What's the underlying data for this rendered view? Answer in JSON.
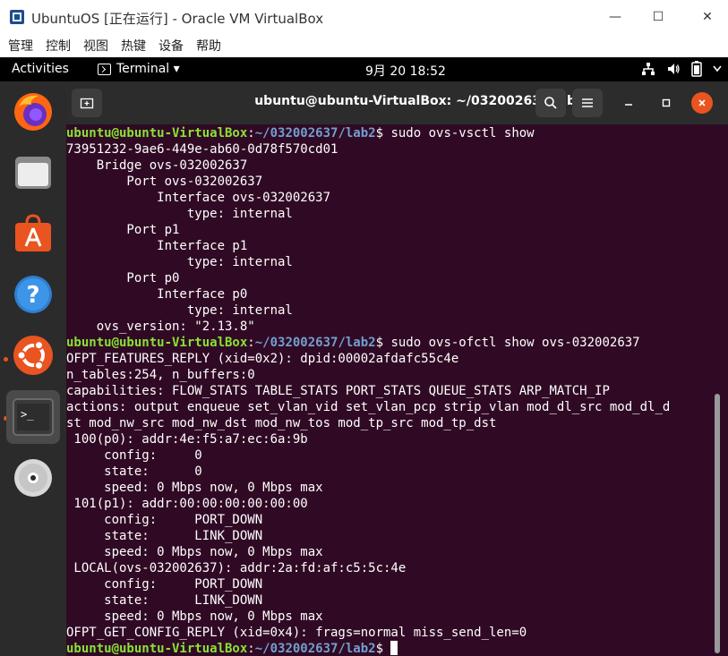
{
  "window": {
    "title": "UbuntuOS [正在运行] - Oracle VM VirtualBox",
    "minimize_glyph": "—",
    "maximize_glyph": "☐",
    "close_glyph": "✕"
  },
  "menubar": {
    "items": [
      "管理",
      "控制",
      "视图",
      "热键",
      "设备",
      "帮助"
    ]
  },
  "topbar": {
    "activities": "Activities",
    "app_menu": "Terminal ▾",
    "clock": "9月 20  18:52",
    "tray_icons": [
      "network-icon",
      "volume-icon",
      "battery-icon",
      "power-menu-icon"
    ]
  },
  "dock": {
    "items": [
      "firefox-icon",
      "files-icon",
      "software-icon",
      "help-icon",
      "ubuntu-icon",
      "terminal-icon",
      "disc-icon"
    ]
  },
  "terminal": {
    "title": "ubuntu@ubuntu-VirtualBox: ~/032002637/lab2",
    "prompt_user": "ubuntu@ubuntu-VirtualBox",
    "prompt_sep": ":",
    "prompt_path": "~/032002637/lab2",
    "prompt_end": "$ ",
    "lines": [
      {
        "type": "cmd",
        "text": "sudo ovs-vsctl show"
      },
      {
        "type": "out",
        "text": "73951232-9ae6-449e-ab60-0d78f570cd01"
      },
      {
        "type": "out",
        "text": "    Bridge ovs-032002637"
      },
      {
        "type": "out",
        "text": "        Port ovs-032002637"
      },
      {
        "type": "out",
        "text": "            Interface ovs-032002637"
      },
      {
        "type": "out",
        "text": "                type: internal"
      },
      {
        "type": "out",
        "text": "        Port p1"
      },
      {
        "type": "out",
        "text": "            Interface p1"
      },
      {
        "type": "out",
        "text": "                type: internal"
      },
      {
        "type": "out",
        "text": "        Port p0"
      },
      {
        "type": "out",
        "text": "            Interface p0"
      },
      {
        "type": "out",
        "text": "                type: internal"
      },
      {
        "type": "out",
        "text": "    ovs_version: \"2.13.8\""
      },
      {
        "type": "cmd",
        "text": "sudo ovs-ofctl show ovs-032002637"
      },
      {
        "type": "out",
        "text": "OFPT_FEATURES_REPLY (xid=0x2): dpid:00002afdafc55c4e"
      },
      {
        "type": "out",
        "text": "n_tables:254, n_buffers:0"
      },
      {
        "type": "out",
        "text": "capabilities: FLOW_STATS TABLE_STATS PORT_STATS QUEUE_STATS ARP_MATCH_IP"
      },
      {
        "type": "out",
        "text": "actions: output enqueue set_vlan_vid set_vlan_pcp strip_vlan mod_dl_src mod_dl_d"
      },
      {
        "type": "out",
        "text": "st mod_nw_src mod_nw_dst mod_nw_tos mod_tp_src mod_tp_dst"
      },
      {
        "type": "out",
        "text": " 100(p0): addr:4e:f5:a7:ec:6a:9b"
      },
      {
        "type": "out",
        "text": "     config:     0"
      },
      {
        "type": "out",
        "text": "     state:      0"
      },
      {
        "type": "out",
        "text": "     speed: 0 Mbps now, 0 Mbps max"
      },
      {
        "type": "out",
        "text": " 101(p1): addr:00:00:00:00:00:00"
      },
      {
        "type": "out",
        "text": "     config:     PORT_DOWN"
      },
      {
        "type": "out",
        "text": "     state:      LINK_DOWN"
      },
      {
        "type": "out",
        "text": "     speed: 0 Mbps now, 0 Mbps max"
      },
      {
        "type": "out",
        "text": " LOCAL(ovs-032002637): addr:2a:fd:af:c5:5c:4e"
      },
      {
        "type": "out",
        "text": "     config:     PORT_DOWN"
      },
      {
        "type": "out",
        "text": "     state:      LINK_DOWN"
      },
      {
        "type": "out",
        "text": "     speed: 0 Mbps now, 0 Mbps max"
      },
      {
        "type": "out",
        "text": "OFPT_GET_CONFIG_REPLY (xid=0x4): frags=normal miss_send_len=0"
      },
      {
        "type": "prompt",
        "text": ""
      }
    ]
  },
  "colors": {
    "terminal_bg": "#300a24",
    "prompt_user": "#8ae234",
    "prompt_path": "#729fcf",
    "ubuntu_orange": "#e95420"
  }
}
